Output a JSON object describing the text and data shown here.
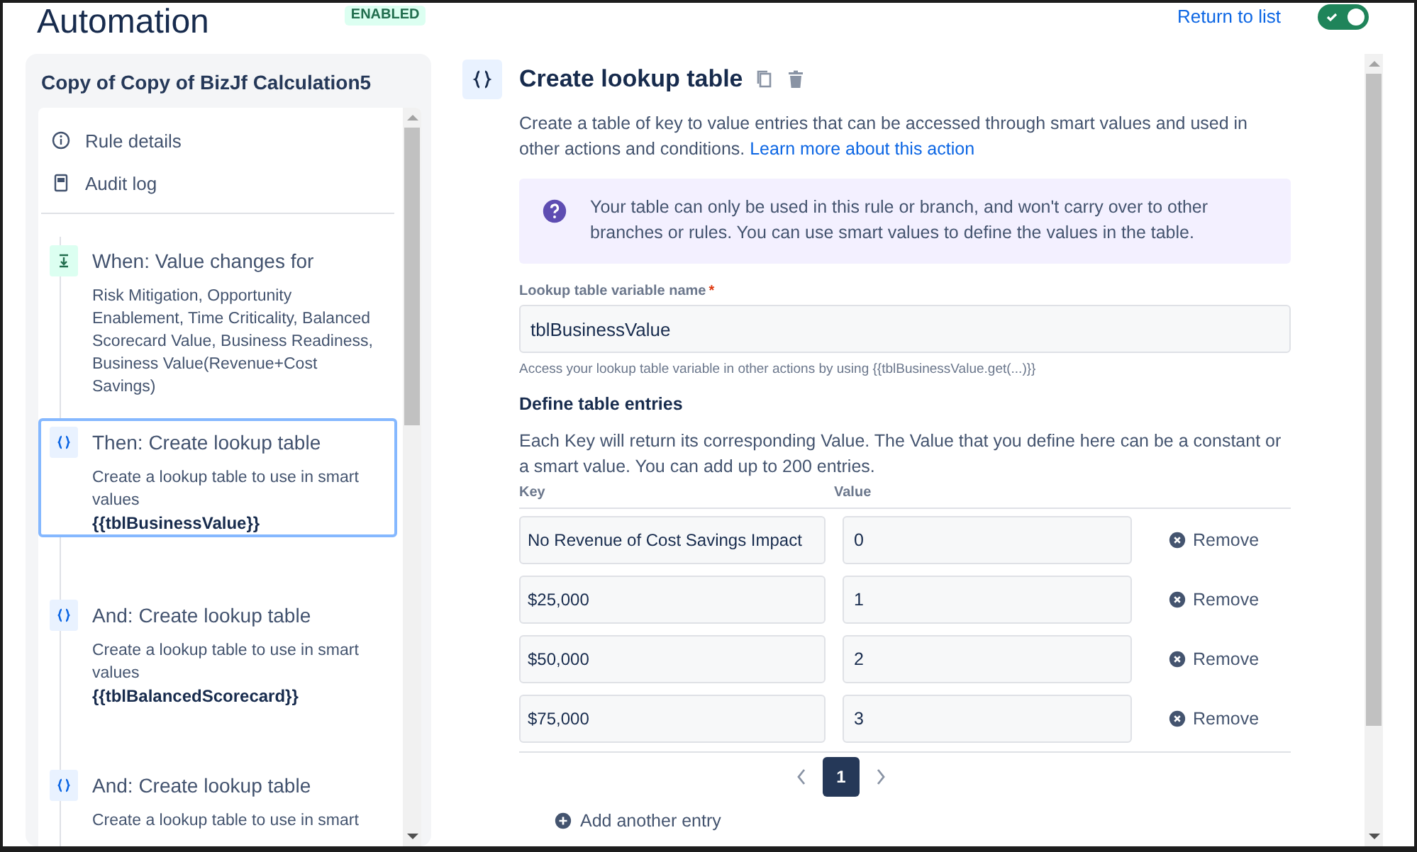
{
  "header": {
    "title": "Automation",
    "status": "ENABLED",
    "return_link": "Return to list",
    "toggle_on": true
  },
  "sidebar": {
    "title": "Copy of Copy of BizJf Calculation5",
    "nav": [
      {
        "kind": "info",
        "label": "Rule details"
      },
      {
        "kind": "log",
        "label": "Audit log"
      }
    ],
    "steps": [
      {
        "kind": "trigger",
        "title": "When: Value changes for",
        "description": "Risk Mitigation, Opportunity Enablement, Time Criticality, Balanced Scorecard Value, Business Readiness, Business Value(Revenue+Cost Savings)",
        "selected": false
      },
      {
        "kind": "action",
        "title": "Then: Create lookup table",
        "description": "Create a lookup table to use in smart values",
        "variable": "{{tblBusinessValue}}",
        "selected": true
      },
      {
        "kind": "action",
        "title": "And: Create lookup table",
        "description": "Create a lookup table to use in smart values",
        "variable": "{{tblBalancedScorecard}}",
        "selected": false
      },
      {
        "kind": "action",
        "title": "And: Create lookup table",
        "description": "Create a lookup table to use in smart",
        "selected": false
      }
    ]
  },
  "main": {
    "title": "Create lookup table",
    "description": "Create a table of key to value entries that can be accessed through smart values and used in other actions and conditions.",
    "link": "Learn more about this action",
    "info": "Your table can only be used in this rule or branch, and won't carry over to other branches or rules. You can use smart values to define the values in the table.",
    "field": {
      "label": "Lookup table variable name",
      "required": true,
      "required_mark": "*",
      "value": "tblBusinessValue",
      "helper": "Access your lookup table variable in other actions by using {{tblBusinessValue.get(...)}}"
    },
    "section": {
      "title": "Define table entries",
      "description": "Each Key will return its corresponding Value. The Value that you define here can be a constant or a smart value. You can add up to 200 entries."
    },
    "columns": [
      "Key",
      "Value"
    ],
    "rows": [
      {
        "key": "No Revenue of Cost Savings Impact",
        "value": "0",
        "action": "Remove"
      },
      {
        "key": "$25,000",
        "value": "1",
        "action": "Remove"
      },
      {
        "key": "$50,000",
        "value": "2",
        "action": "Remove"
      },
      {
        "key": "$75,000",
        "value": "3",
        "action": "Remove"
      }
    ],
    "pages": [
      {
        "label": "1",
        "selected": true
      }
    ],
    "add_label": "Add another entry"
  }
}
